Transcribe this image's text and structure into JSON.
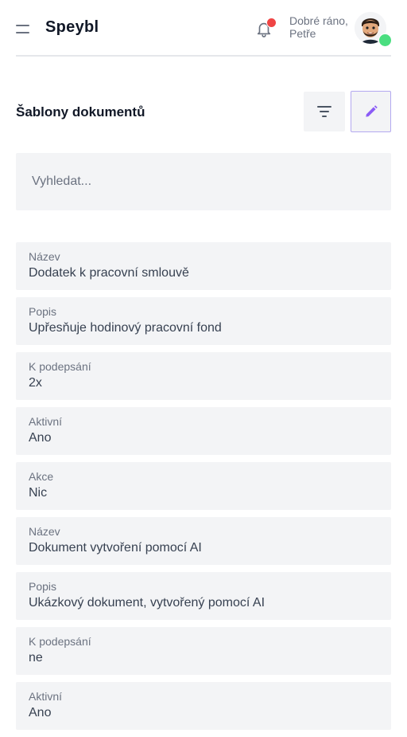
{
  "header": {
    "brand": "Speybl",
    "greeting_line1": "Dobré ráno,",
    "greeting_line2": "Petře",
    "icons": {
      "menu": "menu-icon",
      "notifications": "bell-icon",
      "avatar": "avatar"
    },
    "notification_dot_color": "#ef4444",
    "status_dot_color": "#4ade80"
  },
  "page": {
    "title": "Šablony dokumentů",
    "filter_icon": "filter-icon",
    "edit_icon": "pencil-icon",
    "accent": "#8b5cf6"
  },
  "search": {
    "placeholder": "Vyhledat..."
  },
  "records": [
    {
      "label": "Název",
      "value": "Dodatek k pracovní smlouvě"
    },
    {
      "label": "Popis",
      "value": "Upřesňuje hodinový pracovní fond"
    },
    {
      "label": "K podepsání",
      "value": "2x"
    },
    {
      "label": "Aktivní",
      "value": "Ano"
    },
    {
      "label": "Akce",
      "value": "Nic"
    },
    {
      "label": "Název",
      "value": "Dokument vytvoření pomocí AI"
    },
    {
      "label": "Popis",
      "value": "Ukázkový dokument, vytvořený pomocí AI"
    },
    {
      "label": "K podepsání",
      "value": "ne"
    },
    {
      "label": "Aktivní",
      "value": "Ano"
    }
  ]
}
